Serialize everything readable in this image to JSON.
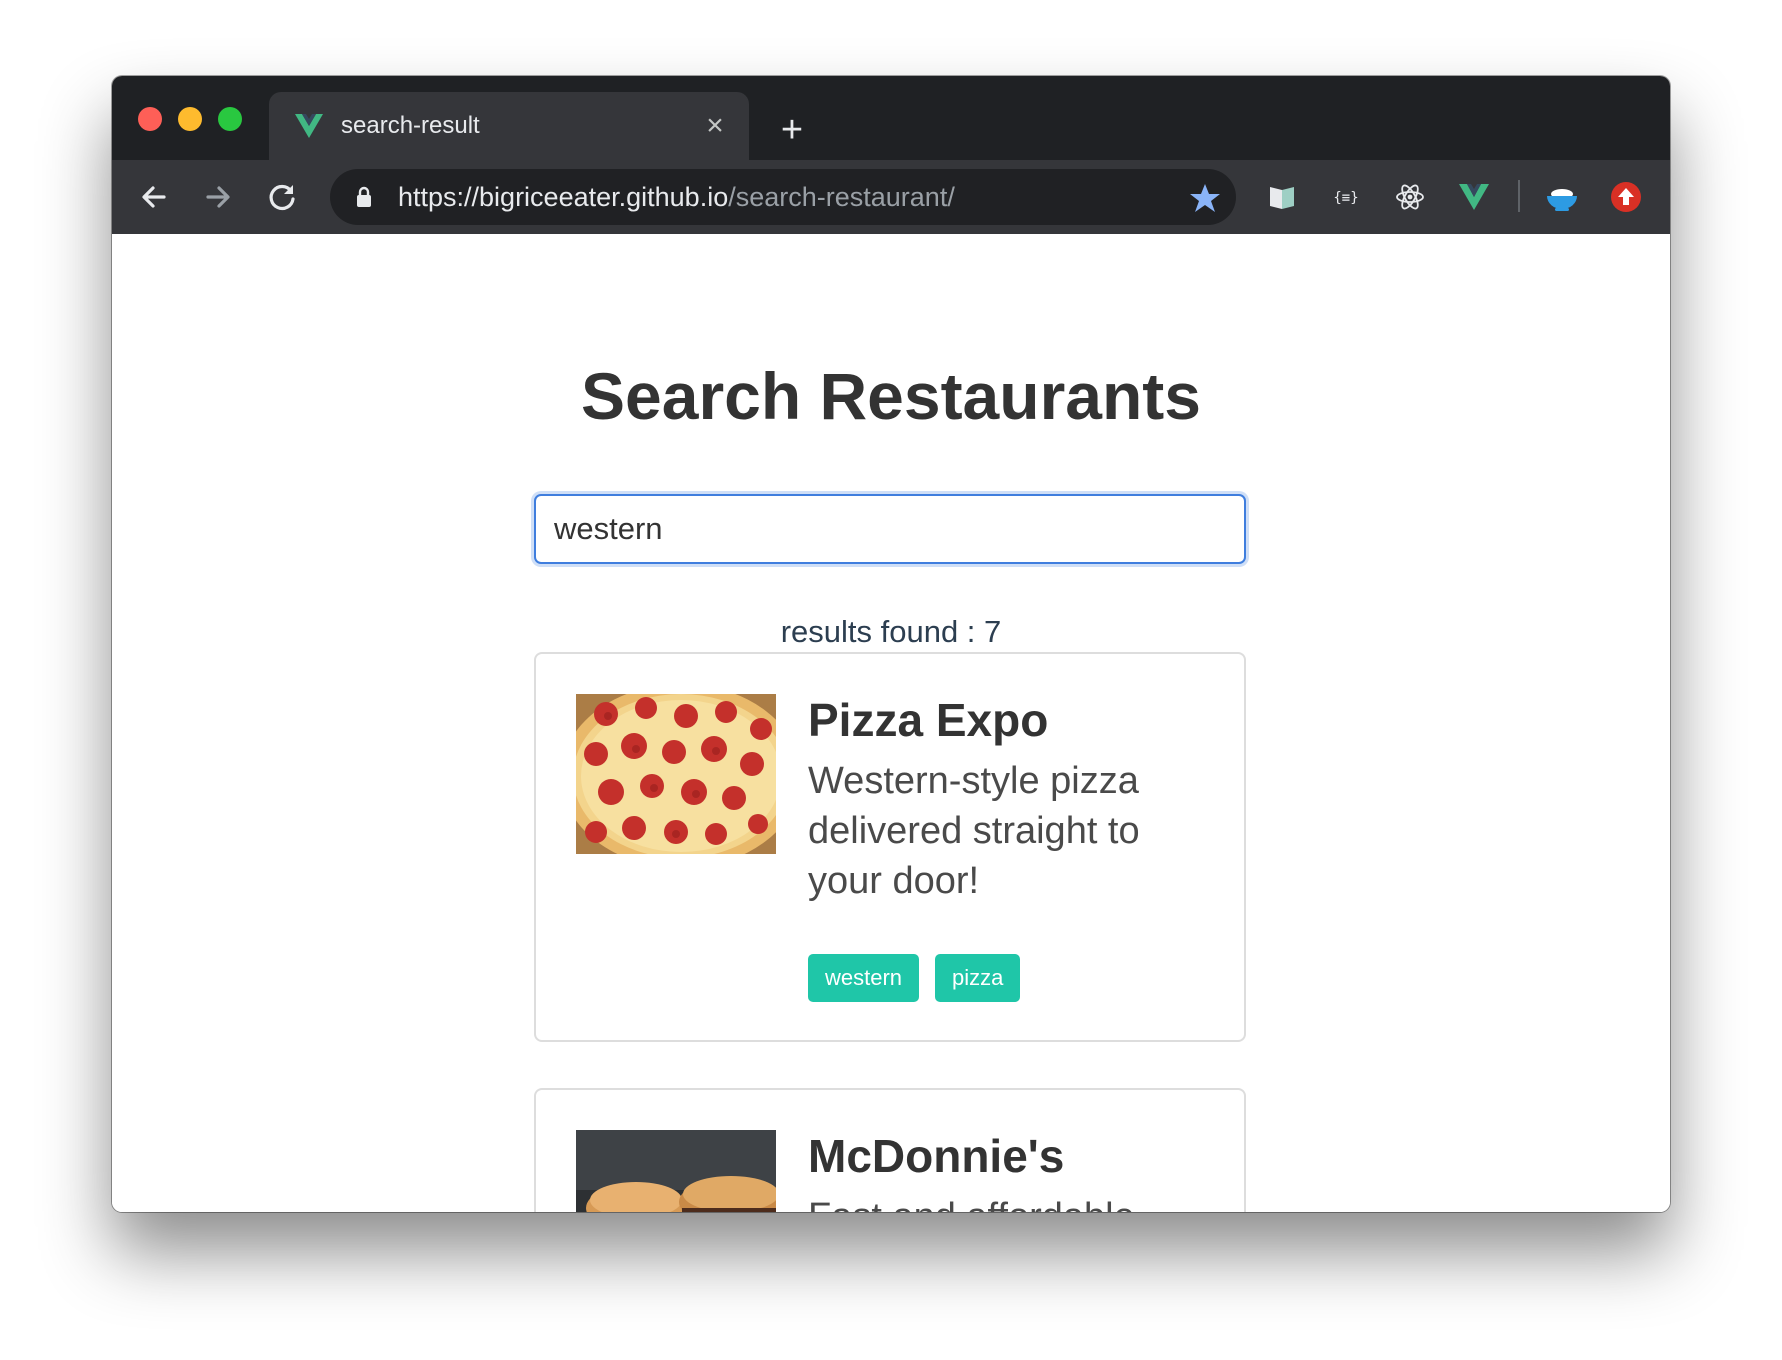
{
  "browser": {
    "tab_title": "search-result",
    "tab_close_icon": "close-icon",
    "new_tab_icon": "plus-icon",
    "url_host": "https://bigriceeater.github.io",
    "url_path": "/search-restaurant/",
    "colors": {
      "titlebar": "#1f2124",
      "toolbar": "#35363a",
      "omnibox": "#202124",
      "star": "#8ab4f8"
    }
  },
  "page": {
    "title": "Search Restaurants",
    "search": {
      "value": "western",
      "placeholder": ""
    },
    "results_label": "results found : 7",
    "restaurants": [
      {
        "name": "Pizza Expo",
        "description": "Western-style pizza delivered straight to your door!",
        "tags": [
          "western",
          "pizza"
        ],
        "image": "pizza-photo"
      },
      {
        "name": "McDonnie's",
        "description": "Fast and affordable",
        "image": "burger-photo"
      }
    ],
    "colors": {
      "tag": "#1fc6a8",
      "input_border": "#3f7ede",
      "title": "#333333"
    }
  }
}
